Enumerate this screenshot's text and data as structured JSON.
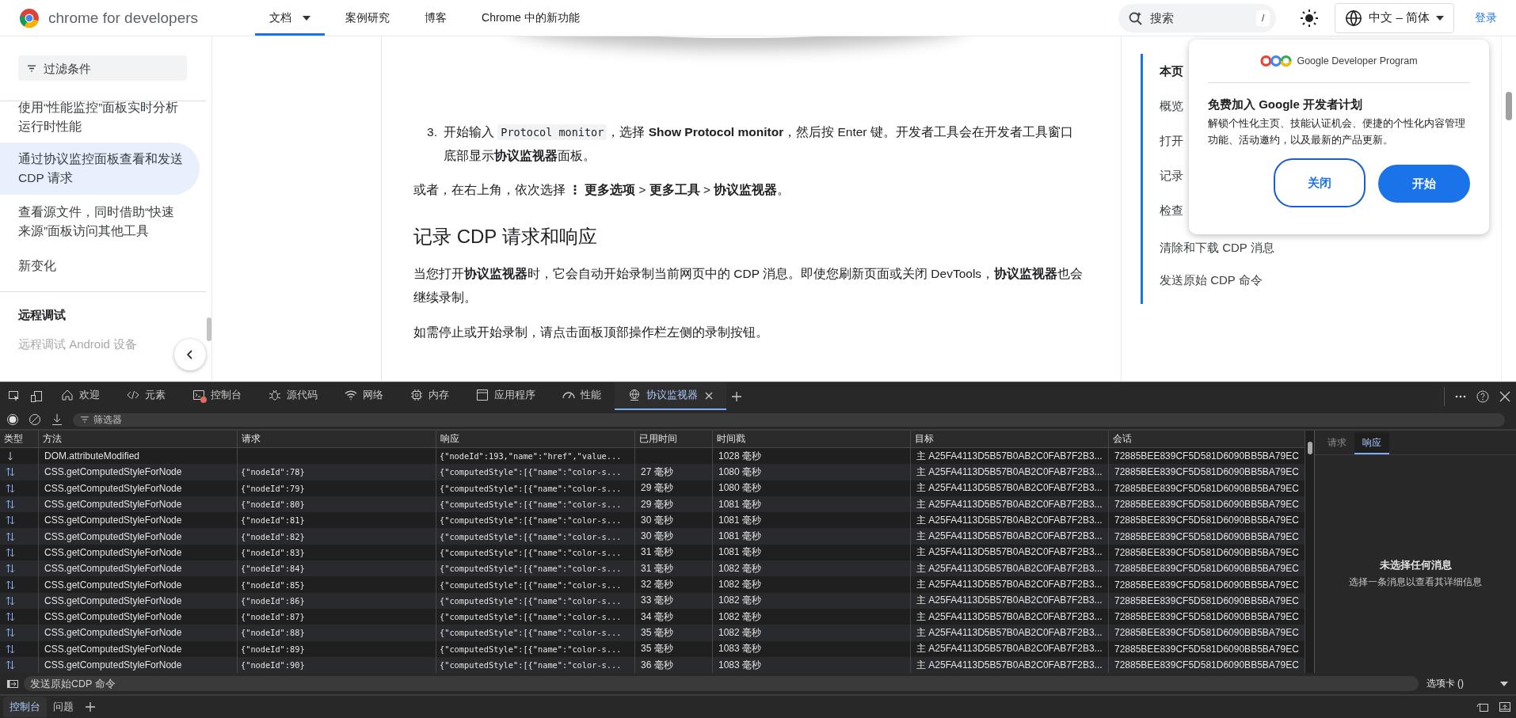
{
  "header": {
    "logo_text": "chrome for developers",
    "nav": [
      {
        "label": "文档",
        "selected": true,
        "dropdown": true
      },
      {
        "label": "案例研究",
        "selected": false,
        "dropdown": false
      },
      {
        "label": "博客",
        "selected": false,
        "dropdown": false
      },
      {
        "label": "Chrome 中的新功能",
        "selected": false,
        "dropdown": false
      }
    ],
    "search": {
      "placeholder": "搜索",
      "shortcut": "/"
    },
    "language": "中文 – 简体",
    "sign_in": "登录"
  },
  "sidebar": {
    "filter": {
      "placeholder": "过滤条件"
    },
    "items": [
      {
        "label": "使用“性能监控”面板实时分析运行时性能",
        "selected": false
      },
      {
        "label": "通过协议监控面板查看和发送 CDP 请求",
        "selected": true
      },
      {
        "label": "查看源文件，同时借助“快速来源”面板访问其他工具",
        "selected": false
      },
      {
        "label": "新变化",
        "selected": false
      }
    ],
    "section_title": "远程调试",
    "faded_item": "远程调试 Android 设备"
  },
  "article": [
    {
      "kind": "step",
      "number": "3.",
      "segments": [
        {
          "kind": "text",
          "text": "开始输入 "
        },
        {
          "kind": "code",
          "text": "Protocol monitor"
        },
        {
          "kind": "text",
          "text": "，选择 **Show Protocol monitor**，然后按 Enter 键。开发者工具会在开发者工具窗口底部显示**协议监视器**面板。"
        }
      ]
    },
    {
      "kind": "paragraph",
      "text": "或者，在右上角，依次选择 **⋮** **更多选项** > **更多工具** > **协议监视器**。"
    },
    {
      "kind": "heading",
      "text": "记录 CDP 请求和响应"
    },
    {
      "kind": "paragraph",
      "text": "当您打开**协议监视器**时，它会自动开始录制当前网页中的 CDP 消息。即使您刷新页面或关闭 DevTools，**协议监视器**也会继续录制。"
    },
    {
      "kind": "paragraph",
      "text": "如需停止或开始录制，请点击面板顶部操作栏左侧的录制按钮。"
    }
  ],
  "toc": {
    "title": "本页",
    "items": [
      "概览",
      "打开",
      "记录",
      "检查",
      "清除和下载 CDP 消息",
      "发送原始 CDP 命令"
    ]
  },
  "popup": {
    "brand": "Google Developer Program",
    "title": "免费加入 Google 开发者计划",
    "body": "解锁个性化主页、技能认证机会、便捷的个性化内容管理功能、活动邀约，以及最新的产品更新。",
    "buttons": [
      {
        "label": "关闭",
        "primary": false
      },
      {
        "label": "开始",
        "primary": true
      }
    ]
  },
  "devtools": {
    "tabs": [
      {
        "label": "欢迎",
        "selected": false,
        "error_badge": false,
        "closable": false
      },
      {
        "label": "元素",
        "selected": false,
        "error_badge": false,
        "closable": false
      },
      {
        "label": "控制台",
        "selected": false,
        "error_badge": true,
        "closable": false
      },
      {
        "label": "源代码",
        "selected": false,
        "error_badge": false,
        "closable": false
      },
      {
        "label": "网络",
        "selected": false,
        "error_badge": false,
        "closable": false
      },
      {
        "label": "内存",
        "selected": false,
        "error_badge": false,
        "closable": false
      },
      {
        "label": "应用程序",
        "selected": false,
        "error_badge": false,
        "closable": false
      },
      {
        "label": "性能",
        "selected": false,
        "error_badge": false,
        "closable": false
      },
      {
        "label": "协议监视器",
        "selected": true,
        "error_badge": false,
        "closable": true
      }
    ],
    "toolbar": {
      "recording": true,
      "filter_placeholder": "筛选器"
    },
    "columns": [
      "类型",
      "方法",
      "请求",
      "响应",
      "已用时间",
      "时间戳",
      "目标",
      "会话"
    ],
    "rows": [
      {
        "kind": "event",
        "method": "DOM.attributeModified",
        "response": "{\"nodeId\":193,\"name\":\"href\",\"value...",
        "timestamp": "1028 毫秒",
        "target": "主 A25FA4113D5B57B0AB2C0FAB7F2B3...",
        "session": "72885BEE839CF5D581D6090BB5BA79EC"
      },
      {
        "kind": "command",
        "method": "CSS.getComputedStyleForNode",
        "request": "{\"nodeId\":78}",
        "response": "{\"computedStyle\":[{\"name\":\"color-s...",
        "elapsed": "27 毫秒",
        "timestamp": "1080 毫秒",
        "target": "主 A25FA4113D5B57B0AB2C0FAB7F2B3...",
        "session": "72885BEE839CF5D581D6090BB5BA79EC"
      },
      {
        "kind": "command",
        "method": "CSS.getComputedStyleForNode",
        "request": "{\"nodeId\":79}",
        "response": "{\"computedStyle\":[{\"name\":\"color-s...",
        "elapsed": "29 毫秒",
        "timestamp": "1080 毫秒",
        "target": "主 A25FA4113D5B57B0AB2C0FAB7F2B3...",
        "session": "72885BEE839CF5D581D6090BB5BA79EC"
      },
      {
        "kind": "command",
        "method": "CSS.getComputedStyleForNode",
        "request": "{\"nodeId\":80}",
        "response": "{\"computedStyle\":[{\"name\":\"color-s...",
        "elapsed": "29 毫秒",
        "timestamp": "1081 毫秒",
        "target": "主 A25FA4113D5B57B0AB2C0FAB7F2B3...",
        "session": "72885BEE839CF5D581D6090BB5BA79EC"
      },
      {
        "kind": "command",
        "method": "CSS.getComputedStyleForNode",
        "request": "{\"nodeId\":81}",
        "response": "{\"computedStyle\":[{\"name\":\"color-s...",
        "elapsed": "30 毫秒",
        "timestamp": "1081 毫秒",
        "target": "主 A25FA4113D5B57B0AB2C0FAB7F2B3...",
        "session": "72885BEE839CF5D581D6090BB5BA79EC"
      },
      {
        "kind": "command",
        "method": "CSS.getComputedStyleForNode",
        "request": "{\"nodeId\":82}",
        "response": "{\"computedStyle\":[{\"name\":\"color-s...",
        "elapsed": "30 毫秒",
        "timestamp": "1081 毫秒",
        "target": "主 A25FA4113D5B57B0AB2C0FAB7F2B3...",
        "session": "72885BEE839CF5D581D6090BB5BA79EC"
      },
      {
        "kind": "command",
        "method": "CSS.getComputedStyleForNode",
        "request": "{\"nodeId\":83}",
        "response": "{\"computedStyle\":[{\"name\":\"color-s...",
        "elapsed": "31 毫秒",
        "timestamp": "1081 毫秒",
        "target": "主 A25FA4113D5B57B0AB2C0FAB7F2B3...",
        "session": "72885BEE839CF5D581D6090BB5BA79EC"
      },
      {
        "kind": "command",
        "method": "CSS.getComputedStyleForNode",
        "request": "{\"nodeId\":84}",
        "response": "{\"computedStyle\":[{\"name\":\"color-s...",
        "elapsed": "31 毫秒",
        "timestamp": "1082 毫秒",
        "target": "主 A25FA4113D5B57B0AB2C0FAB7F2B3...",
        "session": "72885BEE839CF5D581D6090BB5BA79EC"
      },
      {
        "kind": "command",
        "method": "CSS.getComputedStyleForNode",
        "request": "{\"nodeId\":85}",
        "response": "{\"computedStyle\":[{\"name\":\"color-s...",
        "elapsed": "32 毫秒",
        "timestamp": "1082 毫秒",
        "target": "主 A25FA4113D5B57B0AB2C0FAB7F2B3...",
        "session": "72885BEE839CF5D581D6090BB5BA79EC"
      },
      {
        "kind": "command",
        "method": "CSS.getComputedStyleForNode",
        "request": "{\"nodeId\":86}",
        "response": "{\"computedStyle\":[{\"name\":\"color-s...",
        "elapsed": "33 毫秒",
        "timestamp": "1082 毫秒",
        "target": "主 A25FA4113D5B57B0AB2C0FAB7F2B3...",
        "session": "72885BEE839CF5D581D6090BB5BA79EC"
      },
      {
        "kind": "command",
        "method": "CSS.getComputedStyleForNode",
        "request": "{\"nodeId\":87}",
        "response": "{\"computedStyle\":[{\"name\":\"color-s...",
        "elapsed": "34 毫秒",
        "timestamp": "1082 毫秒",
        "target": "主 A25FA4113D5B57B0AB2C0FAB7F2B3...",
        "session": "72885BEE839CF5D581D6090BB5BA79EC"
      },
      {
        "kind": "command",
        "method": "CSS.getComputedStyleForNode",
        "request": "{\"nodeId\":88}",
        "response": "{\"computedStyle\":[{\"name\":\"color-s...",
        "elapsed": "35 毫秒",
        "timestamp": "1082 毫秒",
        "target": "主 A25FA4113D5B57B0AB2C0FAB7F2B3...",
        "session": "72885BEE839CF5D581D6090BB5BA79EC"
      },
      {
        "kind": "command",
        "method": "CSS.getComputedStyleForNode",
        "request": "{\"nodeId\":89}",
        "response": "{\"computedStyle\":[{\"name\":\"color-s...",
        "elapsed": "35 毫秒",
        "timestamp": "1083 毫秒",
        "target": "主 A25FA4113D5B57B0AB2C0FAB7F2B3...",
        "session": "72885BEE839CF5D581D6090BB5BA79EC"
      },
      {
        "kind": "command",
        "method": "CSS.getComputedStyleForNode",
        "request": "{\"nodeId\":90}",
        "response": "{\"computedStyle\":[{\"name\":\"color-s...",
        "elapsed": "36 毫秒",
        "timestamp": "1083 毫秒",
        "target": "主 A25FA4113D5B57B0AB2C0FAB7F2B3...",
        "session": "72885BEE839CF5D581D6090BB5BA79EC"
      }
    ],
    "detail": {
      "tabs": [
        {
          "label": "请求",
          "selected": false
        },
        {
          "label": "响应",
          "selected": true
        }
      ],
      "empty_title": "未选择任何消息",
      "empty_hint": "选择一条消息以查看其详细信息"
    },
    "command_bar": {
      "placeholder": "发送原始CDP 命令",
      "target": "选项卡 ()"
    },
    "drawer_tabs": [
      {
        "label": "控制台",
        "selected": true
      },
      {
        "label": "问题",
        "selected": false
      }
    ]
  }
}
